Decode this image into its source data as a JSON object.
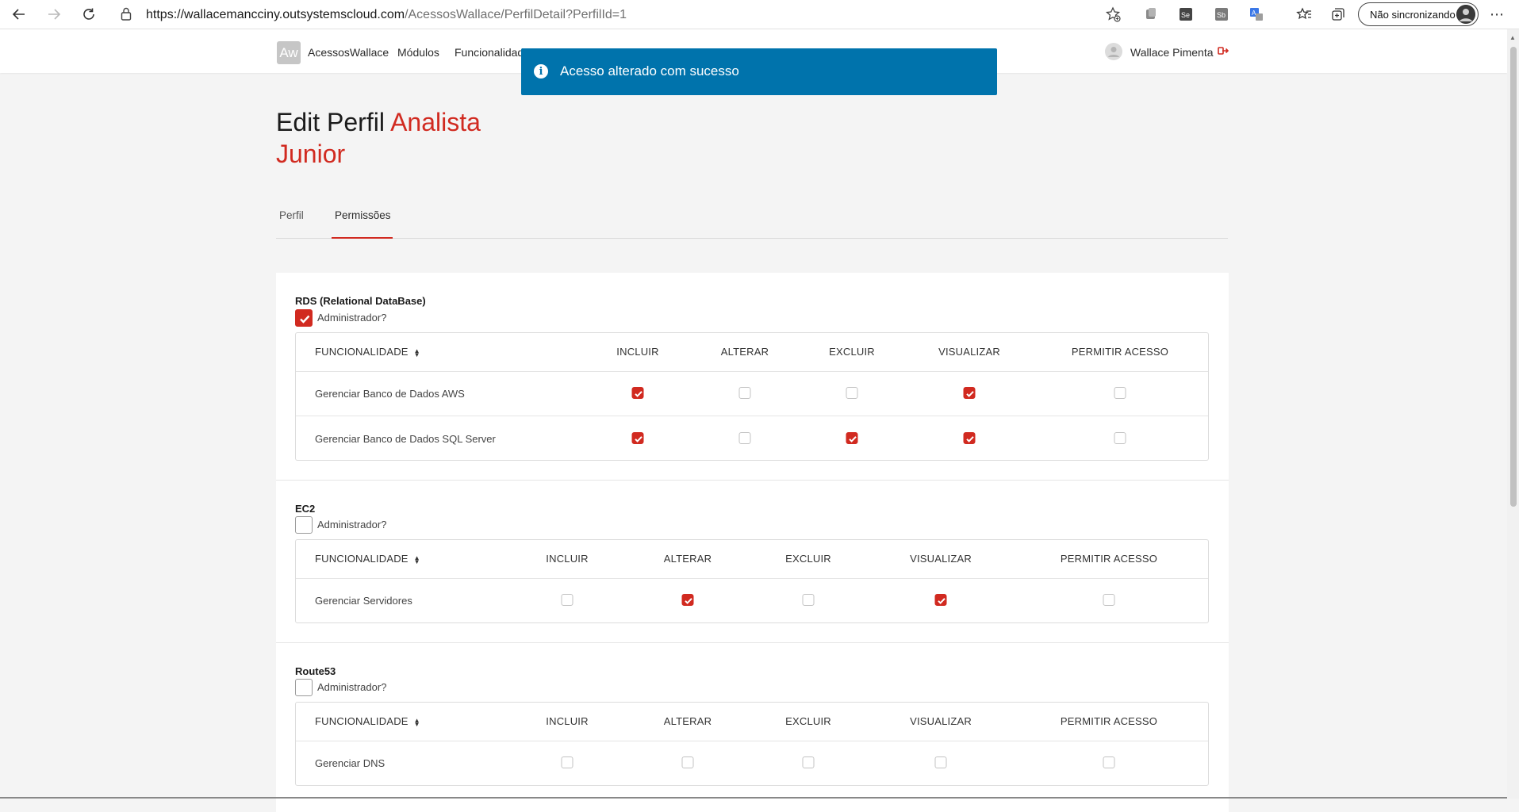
{
  "browser": {
    "url_host": "https://wallacemancciny.outsystemscloud.com",
    "url_path": "/AcessosWallace/PerfilDetail?PerfilId=1",
    "sync_label": "Não sincronizando",
    "menu_glyph": "⋯"
  },
  "header": {
    "logo_text": "Aw",
    "app_name": "AcessosWallace",
    "menu": [
      "Módulos",
      "Funcionalidad"
    ],
    "user_name": "Wallace Pimenta"
  },
  "toast": {
    "message": "Acesso alterado com sucesso",
    "icon": "info-icon",
    "color": "#0073ac"
  },
  "title": {
    "prefix": "Edit Perfil ",
    "name": "Analista Junior",
    "accent_color": "#d12a20"
  },
  "tabs": [
    {
      "label": "Perfil",
      "active": false
    },
    {
      "label": "Permissões",
      "active": true
    }
  ],
  "admin_label": "Administrador?",
  "sections": [
    {
      "title": "RDS (Relational DataBase)",
      "admin": true,
      "columns": [
        "FUNCIONALIDADE",
        "INCLUIR",
        "ALTERAR",
        "EXCLUIR",
        "VISUALIZAR",
        "PERMITIR ACESSO"
      ],
      "rows": [
        {
          "label": "Gerenciar Banco de Dados AWS",
          "perms": [
            true,
            false,
            false,
            true,
            false
          ]
        },
        {
          "label": "Gerenciar Banco de Dados SQL Server",
          "perms": [
            true,
            false,
            true,
            true,
            false
          ]
        }
      ]
    },
    {
      "title": "EC2",
      "admin": false,
      "columns": [
        "FUNCIONALIDADE",
        "INCLUIR",
        "ALTERAR",
        "EXCLUIR",
        "VISUALIZAR",
        "PERMITIR ACESSO"
      ],
      "rows": [
        {
          "label": "Gerenciar Servidores",
          "perms": [
            false,
            true,
            false,
            true,
            false
          ]
        }
      ]
    },
    {
      "title": "Route53",
      "admin": false,
      "columns": [
        "FUNCIONALIDADE",
        "INCLUIR",
        "ALTERAR",
        "EXCLUIR",
        "VISUALIZAR",
        "PERMITIR ACESSO"
      ],
      "rows": [
        {
          "label": "Gerenciar DNS",
          "perms": [
            false,
            false,
            false,
            false,
            false
          ]
        }
      ]
    }
  ]
}
